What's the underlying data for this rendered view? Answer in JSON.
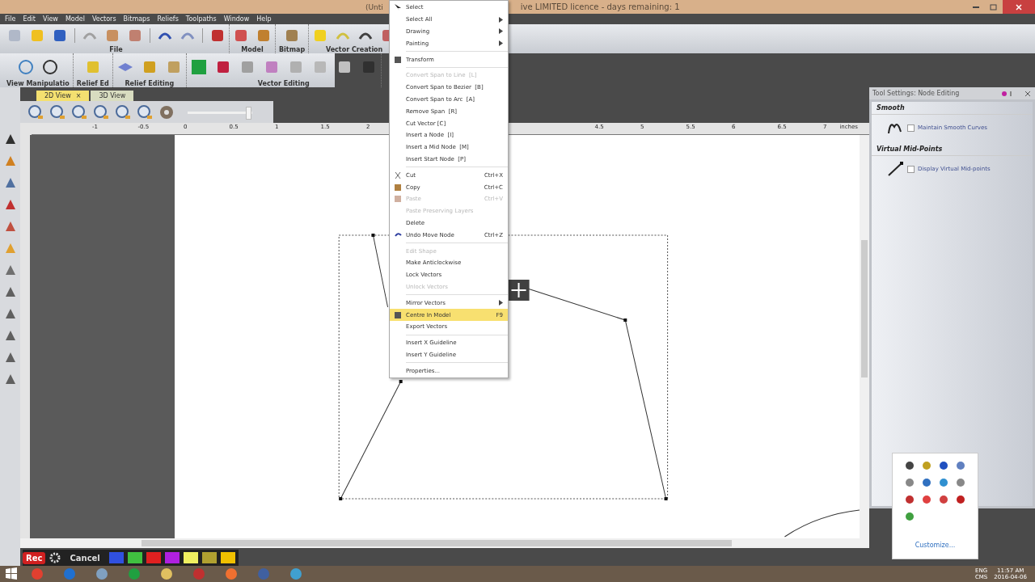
{
  "window": {
    "title_left": "(Unti",
    "title_right": "ive LIMITED licence - days remaining: 1"
  },
  "menu_bar": [
    "File",
    "Edit",
    "View",
    "Model",
    "Vectors",
    "Bitmaps",
    "Reliefs",
    "Toolpaths",
    "Window",
    "Help"
  ],
  "toolbar_groups_top": [
    "File",
    "Model",
    "Bitmap",
    "Vector Creation"
  ],
  "toolbar_groups_bottom": [
    "View Manipulatio",
    "Relief Ed",
    "Relief Editing",
    "Vector Editing"
  ],
  "view_tabs": [
    {
      "label": "2D View",
      "selected": true,
      "close": "×"
    },
    {
      "label": "3D View",
      "selected": false
    }
  ],
  "zoom_slider": {
    "level": 0.95
  },
  "ruler": {
    "labels": [
      "-1",
      "-0.5",
      "0",
      "0.5",
      "1",
      "1.5",
      "2",
      "4.5",
      "5",
      "5.5",
      "6",
      "6.5",
      "7"
    ],
    "units": "inches"
  },
  "context_menu": [
    {
      "kind": "item",
      "label": "Select",
      "disabled": false,
      "submenu": false,
      "selected": false
    },
    {
      "kind": "item",
      "label": "Select All",
      "disabled": false,
      "submenu": true,
      "selected": false
    },
    {
      "kind": "item",
      "label": "Drawing",
      "disabled": false,
      "submenu": true,
      "selected": false
    },
    {
      "kind": "item",
      "label": "Painting",
      "disabled": false,
      "submenu": true,
      "selected": false
    },
    {
      "kind": "separator"
    },
    {
      "kind": "item",
      "label": "Transform",
      "disabled": false,
      "submenu": false,
      "selected": false
    },
    {
      "kind": "separator"
    },
    {
      "kind": "item",
      "label": "Convert Span to Line  [L]",
      "disabled": true,
      "submenu": false,
      "selected": false
    },
    {
      "kind": "item",
      "label": "Convert Span to Bezier  [B]",
      "disabled": false,
      "submenu": false,
      "selected": false
    },
    {
      "kind": "item",
      "label": "Convert Span to Arc  [A]",
      "disabled": false,
      "submenu": false,
      "selected": false
    },
    {
      "kind": "item",
      "label": "Remove Span  [R]",
      "disabled": false,
      "submenu": false,
      "selected": false
    },
    {
      "kind": "item",
      "label": "Cut Vector [C]",
      "disabled": false,
      "submenu": false,
      "selected": false
    },
    {
      "kind": "item",
      "label": "Insert a Node  [I]",
      "disabled": false,
      "submenu": false,
      "selected": false
    },
    {
      "kind": "item",
      "label": "Insert a Mid Node  [M]",
      "disabled": false,
      "submenu": false,
      "selected": false
    },
    {
      "kind": "item",
      "label": "Insert Start Node  [P]",
      "disabled": false,
      "submenu": false,
      "selected": false
    },
    {
      "kind": "separator"
    },
    {
      "kind": "item",
      "label": "Cut",
      "shortcut": "Ctrl+X",
      "disabled": false,
      "submenu": false,
      "selected": false
    },
    {
      "kind": "item",
      "label": "Copy",
      "shortcut": "Ctrl+C",
      "disabled": false,
      "submenu": false,
      "selected": false
    },
    {
      "kind": "item",
      "label": "Paste",
      "shortcut": "Ctrl+V",
      "disabled": true,
      "submenu": false,
      "selected": false
    },
    {
      "kind": "item",
      "label": "Paste Preserving Layers",
      "disabled": true,
      "submenu": false,
      "selected": false
    },
    {
      "kind": "item",
      "label": "Delete",
      "disabled": false,
      "submenu": false,
      "selected": false
    },
    {
      "kind": "item",
      "label": "Undo Move Node",
      "shortcut": "Ctrl+Z",
      "disabled": false,
      "submenu": false,
      "selected": false
    },
    {
      "kind": "separator"
    },
    {
      "kind": "item",
      "label": "Edit Shape",
      "disabled": true,
      "submenu": false,
      "selected": false
    },
    {
      "kind": "item",
      "label": "Make Anticlockwise",
      "disabled": false,
      "submenu": false,
      "selected": false
    },
    {
      "kind": "item",
      "label": "Lock Vectors",
      "disabled": false,
      "submenu": false,
      "selected": false
    },
    {
      "kind": "item",
      "label": "Unlock Vectors",
      "disabled": true,
      "submenu": false,
      "selected": false
    },
    {
      "kind": "separator"
    },
    {
      "kind": "item",
      "label": "Mirror Vectors",
      "disabled": false,
      "submenu": true,
      "selected": false
    },
    {
      "kind": "item",
      "label": "Centre In Model",
      "shortcut": "F9",
      "disabled": false,
      "submenu": false,
      "selected": true
    },
    {
      "kind": "item",
      "label": "Export Vectors",
      "disabled": false,
      "submenu": false,
      "selected": false
    },
    {
      "kind": "separator"
    },
    {
      "kind": "item",
      "label": "Insert X Guideline",
      "disabled": false,
      "submenu": false,
      "selected": false
    },
    {
      "kind": "item",
      "label": "Insert Y Guideline",
      "disabled": false,
      "submenu": false,
      "selected": false
    },
    {
      "kind": "separator"
    },
    {
      "kind": "item",
      "label": "Properties...",
      "disabled": false,
      "submenu": false,
      "selected": false
    }
  ],
  "tool_settings": {
    "title": "Tool Settings: Node Editing",
    "sections": [
      {
        "heading": "Smooth",
        "option": "Maintain Smooth Curves",
        "checked": false
      },
      {
        "heading": "Virtual Mid-Points",
        "option": "Display Virtual Mid-points",
        "checked": false
      }
    ]
  },
  "tray_popup": {
    "link": "Customize..."
  },
  "recorder": {
    "rec": "Rec",
    "cancel": "Cancel",
    "swatches": [
      {
        "color": "#3050e0"
      },
      {
        "color": "#40c040"
      },
      {
        "color": "#e02020"
      },
      {
        "color": "#b020e0"
      },
      {
        "color": "#f0f060"
      },
      {
        "color": "#b0a030"
      },
      {
        "color": "#f0c000"
      }
    ]
  },
  "taskbar": {
    "language": "ENG",
    "layout": "CMS",
    "time": "11:57 AM",
    "date": "2016-04-06"
  }
}
